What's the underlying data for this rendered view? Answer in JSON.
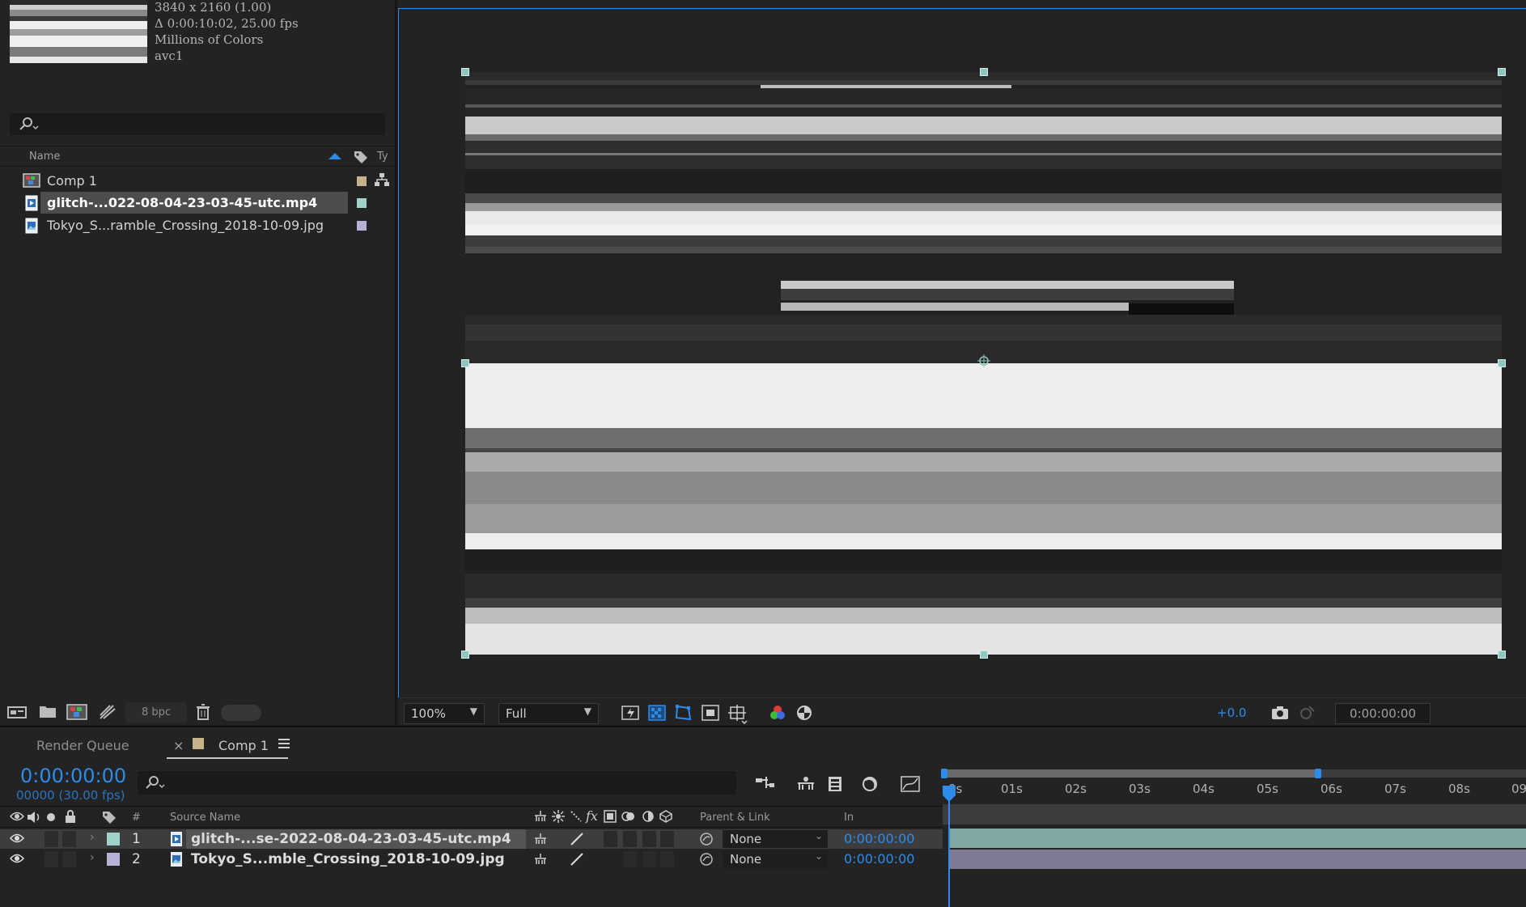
{
  "project": {
    "footage_info": [
      "3840 x 2160 (1.00)",
      "Δ 0:00:10:02, 25.00 fps",
      "Millions of Colors",
      "avc1"
    ],
    "column_name": "Name",
    "column_type": "Ty",
    "items": [
      {
        "label": "Comp 1",
        "type": "composition",
        "swatch": "#c5b38a"
      },
      {
        "label": "glitch-...022-08-04-23-03-45-utc.mp4",
        "type": "footage",
        "swatch": "#9fd2c9",
        "selected": true
      },
      {
        "label": "Tokyo_S...ramble_Crossing_2018-10-09.jpg",
        "type": "image",
        "swatch": "#b7b1d8"
      }
    ],
    "bit_depth": "8 bpc"
  },
  "viewer": {
    "zoom": "100%",
    "resolution": "Full",
    "exposure": "+0.0",
    "timecode": "0:00:00:00"
  },
  "timeline": {
    "tabs": {
      "render_queue": "Render Queue",
      "comp": "Comp 1",
      "close": "×"
    },
    "current_time": "0:00:00:00",
    "frame_info": "00000 (30.00 fps)",
    "headers": {
      "num": "#",
      "source_name": "Source Name",
      "parent": "Parent & Link",
      "in": "In"
    },
    "layers": [
      {
        "num": "1",
        "name": "glitch-...se-2022-08-04-23-03-45-utc.mp4",
        "parent": "None",
        "in": "0:00:00:00",
        "swatch": "#9fd2c9",
        "selected": true
      },
      {
        "num": "2",
        "name": "Tokyo_S...mble_Crossing_2018-10-09.jpg",
        "parent": "None",
        "in": "0:00:00:00",
        "swatch": "#b7b1d8"
      }
    ],
    "ruler_ticks": [
      "0s",
      "01s",
      "02s",
      "03s",
      "04s",
      "05s",
      "06s",
      "07s",
      "08s",
      "09"
    ]
  },
  "colors": {
    "accent": "#2d8ceb",
    "panel": "#232323",
    "layer1": "#7fa8a4",
    "layer2": "#7d7b94"
  }
}
